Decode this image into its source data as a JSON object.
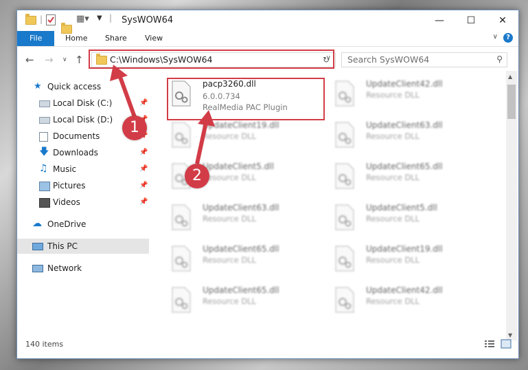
{
  "window": {
    "title": "SysWOW64"
  },
  "ribbon": {
    "tabs": [
      "File",
      "Home",
      "Share",
      "View"
    ],
    "help": "?"
  },
  "address": {
    "path": "C:\\Windows\\SysWOW64"
  },
  "search": {
    "placeholder": "Search SysWOW64"
  },
  "sidebar": {
    "items": [
      {
        "label": "Quick access"
      },
      {
        "label": "Local Disk (C:)"
      },
      {
        "label": "Local Disk (D:)"
      },
      {
        "label": "Documents"
      },
      {
        "label": "Downloads"
      },
      {
        "label": "Music"
      },
      {
        "label": "Pictures"
      },
      {
        "label": "Videos"
      },
      {
        "label": "OneDrive"
      },
      {
        "label": "This PC"
      },
      {
        "label": "Network"
      }
    ]
  },
  "files": [
    {
      "name": "pacp3260.dll",
      "version": "6.0.0.734",
      "desc": "RealMedia PAC Plugin"
    },
    {
      "name": "UpdateClient42.dll",
      "desc": "Resource DLL"
    },
    {
      "name": "UpdateClient19.dll",
      "desc": "Resource DLL"
    },
    {
      "name": "UpdateClient63.dll",
      "desc": "Resource DLL"
    },
    {
      "name": "UpdateClient5.dll",
      "desc": "Resource DLL"
    },
    {
      "name": "UpdateClient65.dll",
      "desc": "Resource DLL"
    },
    {
      "name": "UpdateClient63.dll",
      "desc": "Resource DLL"
    },
    {
      "name": "UpdateClient5.dll",
      "desc": "Resource DLL"
    },
    {
      "name": "UpdateClient65.dll",
      "desc": "Resource DLL"
    },
    {
      "name": "UpdateClient19.dll",
      "desc": "Resource DLL"
    },
    {
      "name": "UpdateClient65.dll",
      "desc": "Resource DLL"
    },
    {
      "name": "UpdateClient42.dll",
      "desc": "Resource DLL"
    }
  ],
  "status": {
    "count": "140 items"
  },
  "callouts": [
    "1",
    "2"
  ],
  "colors": {
    "accent": "#1979ca",
    "highlight": "#d23c47"
  }
}
